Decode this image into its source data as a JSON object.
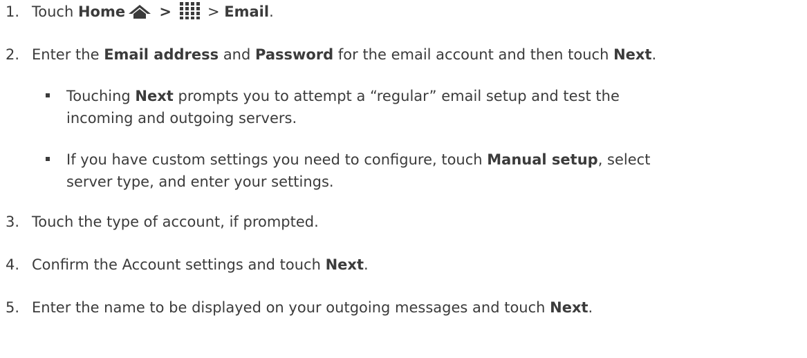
{
  "steps": [
    {
      "num": "1.",
      "t1": "Touch ",
      "b1": "Home",
      "sep1": " > ",
      "sep2": " > ",
      "b2": "Email",
      "end": "."
    },
    {
      "num": "2.",
      "t1": "Enter the ",
      "b1": "Email address",
      "t2": " and ",
      "b2": "Password",
      "t3": " for the email account and then touch ",
      "b3": "Next",
      "end": "."
    },
    {
      "num": "3.",
      "t1": "Touch the type of account, if prompted."
    },
    {
      "num": "4.",
      "t1": "Confirm the Account settings and touch ",
      "b1": "Next",
      "end": "."
    },
    {
      "num": "5.",
      "t1": "Enter the name to be displayed on your outgoing messages and touch ",
      "b1": "Next",
      "end": "."
    }
  ],
  "subs": [
    {
      "a1": "Touching ",
      "ab": "Next",
      "a2": " prompts you to attempt a “regular” email setup and test the",
      "l2": "incoming and outgoing servers."
    },
    {
      "a1": "If you have custom settings you need to configure, touch ",
      "ab": "Manual setup",
      "a2": ", select",
      "l2": "server type, and enter your settings."
    }
  ],
  "icons": {
    "home": "home-icon",
    "apps": "apps-grid-icon"
  },
  "colors": {
    "text": "#3b3b3b"
  }
}
